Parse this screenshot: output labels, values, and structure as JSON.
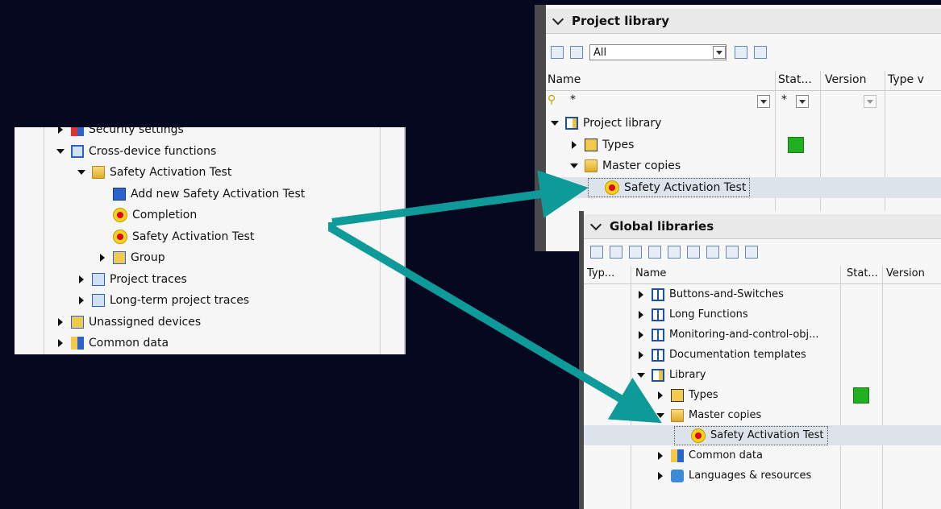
{
  "left_tree": {
    "items": [
      {
        "label": "Security settings",
        "indent": 1,
        "expand": "right",
        "icon": "security-icon"
      },
      {
        "label": "Cross-device functions",
        "indent": 1,
        "expand": "down",
        "icon": "cross-device-icon"
      },
      {
        "label": "Safety Activation Test",
        "indent": 2,
        "expand": "down",
        "icon": "safety-folder-icon"
      },
      {
        "label": "Add new Safety Activation Test",
        "indent": 3,
        "expand": "none",
        "icon": "add-new-icon"
      },
      {
        "label": "Completion",
        "indent": 3,
        "expand": "none",
        "icon": "safety-icon"
      },
      {
        "label": "Safety Activation Test",
        "indent": 3,
        "expand": "none",
        "icon": "safety-icon"
      },
      {
        "label": "Group",
        "indent": 3,
        "expand": "right",
        "icon": "group-icon"
      },
      {
        "label": "Project traces",
        "indent": 2,
        "expand": "right",
        "icon": "trace-icon"
      },
      {
        "label": "Long-term project traces",
        "indent": 2,
        "expand": "right",
        "icon": "trace-icon"
      },
      {
        "label": "Unassigned devices",
        "indent": 1,
        "expand": "right",
        "icon": "unassigned-devices-icon"
      },
      {
        "label": "Common data",
        "indent": 1,
        "expand": "right",
        "icon": "common-data-icon"
      }
    ]
  },
  "project_library": {
    "title": "Project library",
    "filter_value": "All",
    "columns": {
      "name": "Name",
      "status": "Stat...",
      "version": "Version",
      "type": "Type v"
    },
    "filter_text": "*",
    "status_filter": "*",
    "rows": [
      {
        "label": "Project library",
        "indent": 0,
        "expand": "down",
        "icon": "library-icon"
      },
      {
        "label": "Types",
        "indent": 1,
        "expand": "right",
        "icon": "types-icon",
        "status": "green"
      },
      {
        "label": "Master copies",
        "indent": 1,
        "expand": "down",
        "icon": "folder-icon"
      },
      {
        "label": "Safety Activation Test",
        "indent": 2,
        "expand": "none",
        "icon": "safety-icon",
        "selected": true
      }
    ]
  },
  "global_libraries": {
    "title": "Global libraries",
    "columns": {
      "type": "Typ...",
      "name": "Name",
      "status": "Stat...",
      "version": "Version"
    },
    "rows": [
      {
        "label": "Buttons-and-Switches",
        "indent": 0,
        "expand": "right",
        "icon": "book-icon"
      },
      {
        "label": "Long Functions",
        "indent": 0,
        "expand": "right",
        "icon": "book-icon"
      },
      {
        "label": "Monitoring-and-control-obj...",
        "indent": 0,
        "expand": "right",
        "icon": "book-icon"
      },
      {
        "label": "Documentation templates",
        "indent": 0,
        "expand": "right",
        "icon": "book-icon"
      },
      {
        "label": "Library",
        "indent": 0,
        "expand": "down",
        "icon": "library-icon"
      },
      {
        "label": "Types",
        "indent": 1,
        "expand": "right",
        "icon": "types-icon",
        "status": "green"
      },
      {
        "label": "Master copies",
        "indent": 1,
        "expand": "down",
        "icon": "folder-icon"
      },
      {
        "label": "Safety Activation Test",
        "indent": 2,
        "expand": "none",
        "icon": "safety-icon",
        "selected": true
      },
      {
        "label": "Common data",
        "indent": 1,
        "expand": "right",
        "icon": "common-data-icon"
      },
      {
        "label": "Languages & resources",
        "indent": 1,
        "expand": "right",
        "icon": "languages-icon"
      }
    ]
  },
  "colors": {
    "arrow": "#0f9a9a",
    "background": "#06081f",
    "status_ok": "#22b022"
  }
}
